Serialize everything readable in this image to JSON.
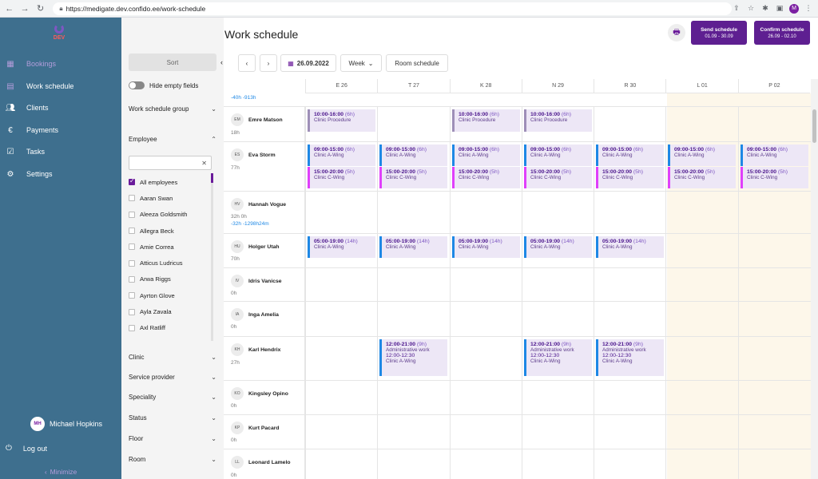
{
  "browser": {
    "url": "https://medigate.dev.confido.ee/work-schedule",
    "profile_initial": "M"
  },
  "sidebar": {
    "env_label": "DEV",
    "items": [
      {
        "label": "Bookings",
        "icon": "calendar-icon",
        "active": true
      },
      {
        "label": "Work schedule",
        "icon": "document-icon",
        "active": false
      },
      {
        "label": "Clients",
        "icon": "people-icon",
        "active": false
      },
      {
        "label": "Payments",
        "icon": "euro-icon",
        "active": false
      },
      {
        "label": "Tasks",
        "icon": "checkbox-icon",
        "active": false
      },
      {
        "label": "Settings",
        "icon": "gear-icon",
        "active": false
      }
    ],
    "user": {
      "initials": "MH",
      "name": "Michael Hopkins"
    },
    "logout_label": "Log out",
    "minimize_label": "Minimize"
  },
  "filters": {
    "sort_label": "Sort",
    "hide_empty_label": "Hide empty fields",
    "group_label": "Work schedule group",
    "employee_label": "Employee",
    "search_clear": "✕",
    "employees": [
      {
        "name": "All employees",
        "checked": true
      },
      {
        "name": "Aaran Swan",
        "checked": false
      },
      {
        "name": "Aleeza Goldsmith",
        "checked": false
      },
      {
        "name": "Allegra Beck",
        "checked": false
      },
      {
        "name": "Amie Correa",
        "checked": false
      },
      {
        "name": "Atticus Ludricus",
        "checked": false
      },
      {
        "name": "Arwa Riggs",
        "checked": false
      },
      {
        "name": "Ayrton Glove",
        "checked": false
      },
      {
        "name": "Ayla Zavala",
        "checked": false
      },
      {
        "name": "Axl Ratliff",
        "checked": false
      }
    ],
    "sections": [
      "Clinic",
      "Service provider",
      "Speciality",
      "Status",
      "Floor",
      "Room"
    ]
  },
  "main": {
    "title": "Work schedule",
    "send": {
      "label": "Send schedule",
      "range": "01.09 - 30.09"
    },
    "confirm": {
      "label": "Confirm schedule",
      "range": "26.09 - 02.10"
    },
    "date": "26.09.2022",
    "view": "Week",
    "room_schedule": "Room schedule",
    "days": [
      "E 26",
      "T 27",
      "K 28",
      "N 29",
      "R 30",
      "L 01",
      "P 02"
    ],
    "top_negative": "-40h -913h"
  },
  "rows": [
    {
      "initials": "EM",
      "name": "Emre Matson",
      "hours": "18h",
      "neg": ""
    },
    {
      "initials": "ES",
      "name": "Eva Storm",
      "hours": "77h",
      "neg": ""
    },
    {
      "initials": "HV",
      "name": "Hannah Vogue",
      "hours": "32h 0h",
      "neg": "-32h -1298h24m"
    },
    {
      "initials": "HU",
      "name": "Holger Utah",
      "hours": "70h",
      "neg": ""
    },
    {
      "initials": "IV",
      "name": "Idris Vanicse",
      "hours": "0h",
      "neg": ""
    },
    {
      "initials": "IA",
      "name": "Inga Amelia",
      "hours": "0h",
      "neg": ""
    },
    {
      "initials": "KH",
      "name": "Karl Hendrix",
      "hours": "27h",
      "neg": ""
    },
    {
      "initials": "KO",
      "name": "Kingsley Opino",
      "hours": "0h",
      "neg": ""
    },
    {
      "initials": "KP",
      "name": "Kurt Pacard",
      "hours": "0h",
      "neg": ""
    },
    {
      "initials": "LL",
      "name": "Leonard Lamelo",
      "hours": "0h",
      "neg": ""
    }
  ],
  "shifts": {
    "proc": {
      "time": "10:00-16:00",
      "dur": "(6h)",
      "place": "Clinic Procedure"
    },
    "a9": {
      "time": "09:00-15:00",
      "dur": "(6h)",
      "place": "Clinic A-Wing"
    },
    "c15": {
      "time": "15:00-20:00",
      "dur": "(5h)",
      "place": "Clinic C-Wing"
    },
    "a5": {
      "time": "05:00-19:00",
      "dur": "(14h)",
      "place": "Clinic A-Wing"
    },
    "admin": {
      "time": "12:00-21:00",
      "dur": "(9h)",
      "type": "Administrative work",
      "break": "12:00-12:30",
      "place": "Clinic A-Wing"
    }
  }
}
